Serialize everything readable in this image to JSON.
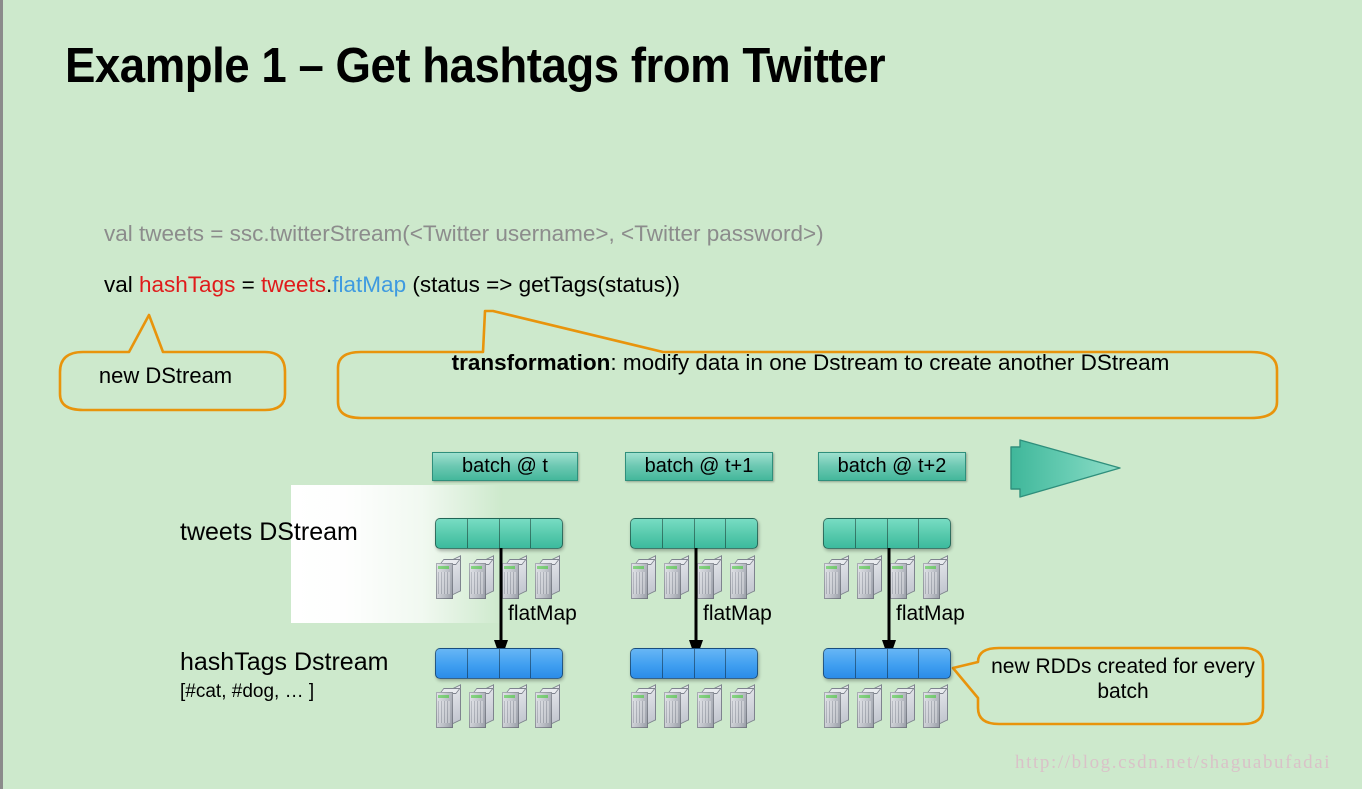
{
  "slide": {
    "title": "Example 1 – Get hashtags from Twitter",
    "background_color": "#cde9cc",
    "watermark": "http://blog.csdn.net/shaguabufadai"
  },
  "code": {
    "line1": "val tweets = ssc.twitterStream(<Twitter username>, <Twitter password>)",
    "line1_color": "#8c8c8c",
    "line2_tokens": {
      "val": "val ",
      "hashTags": "hashTags",
      "equals": " = ",
      "tweets": "tweets",
      "dot": ".",
      "flatMap": "flatMap",
      "rest": " (status => getTags(status))"
    },
    "accent_red": "#e01b1b",
    "accent_blue": "#3f9ae0"
  },
  "callouts": {
    "new_dstream": "new DStream",
    "transformation_bold": "transformation",
    "transformation_rest": ": modify data in one Dstream to create another DStream",
    "new_rdds": "new RDDs created for every batch",
    "outline_color": "#e8940c"
  },
  "diagram": {
    "batch_labels": [
      "batch @ t",
      "batch @ t+1",
      "batch @ t+2"
    ],
    "row_labels": {
      "tweets": "tweets DStream",
      "hashtags": "hashTags Dstream",
      "hashtags_sub": "[#cat, #dog, … ]"
    },
    "transform_label": "flatMap",
    "transform_labels": [
      "flatMap",
      "flatMap",
      "flatMap"
    ],
    "rdd_cells_per_bar": 4,
    "servers_per_row": 4,
    "input_rdd_color": "#3cba9d",
    "output_rdd_color": "#2b8ce8",
    "batch_box_color": "#44b79b",
    "big_arrow_color": "#44b79b"
  }
}
